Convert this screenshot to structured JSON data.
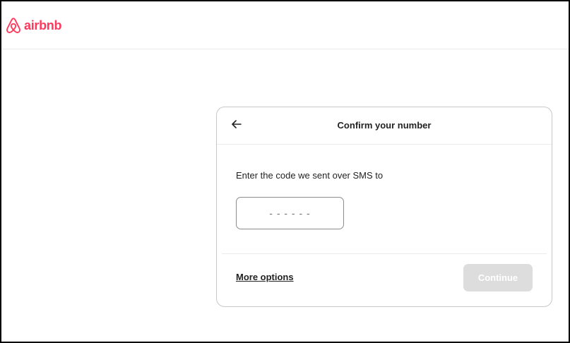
{
  "brand": {
    "name": "airbnb",
    "color": "#ff385c",
    "icon": "airbnb-logo-icon"
  },
  "dialog": {
    "title": "Confirm your number",
    "back_icon": "arrow-left-icon",
    "instructions": "Enter the code we sent over SMS to",
    "code_input": {
      "value": "",
      "placeholder": "- - - - - -"
    },
    "more_options_label": "More options",
    "continue_label": "Continue",
    "continue_disabled": true
  },
  "colors": {
    "accent": "#ff385c",
    "text": "#222222",
    "disabled_button": "#dddddd",
    "border": "#c8c8c8"
  }
}
